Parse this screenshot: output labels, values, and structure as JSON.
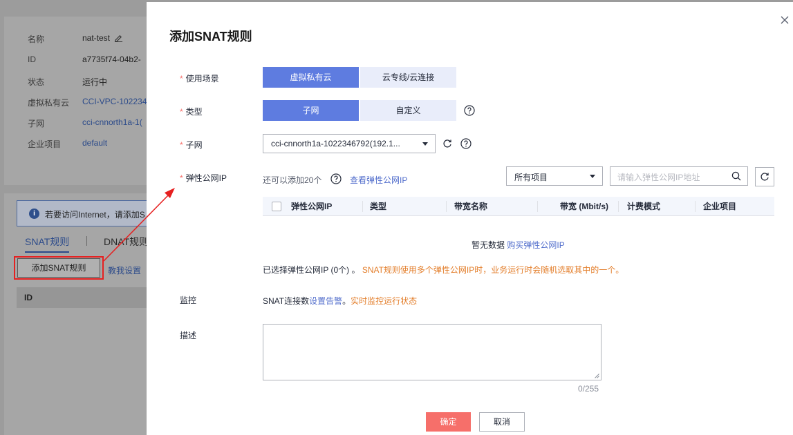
{
  "background": {
    "info": {
      "name_label": "名称",
      "name_value": "nat-test",
      "id_label": "ID",
      "id_value": "a7735f74-04b2-",
      "status_label": "状态",
      "status_value": "运行中",
      "vpc_label": "虚拟私有云",
      "vpc_value": "CCI-VPC-102234",
      "subnet_label": "子网",
      "subnet_value": "cci-cnnorth1a-1(",
      "enterprise_label": "企业项目",
      "enterprise_value": "default"
    },
    "alert_text": "若要访问Internet，请添加S",
    "tab_snat": "SNAT规则",
    "tab_dnat": "DNAT规则",
    "add_snat_button": "添加SNAT规则",
    "teach_link": "教我设置",
    "table_header_id": "ID"
  },
  "dialog": {
    "title": "添加SNAT规则",
    "scene": {
      "label": "使用场景",
      "options": [
        "虚拟私有云",
        "云专线/云连接"
      ],
      "selected": 0
    },
    "type": {
      "label": "类型",
      "options": [
        "子网",
        "自定义"
      ],
      "selected": 0
    },
    "subnet": {
      "label": "子网",
      "value": "cci-cnnorth1a-1022346792(192.1..."
    },
    "eip": {
      "label": "弹性公网IP",
      "remaining": "还可以添加20个",
      "view_link": "查看弹性公网IP",
      "project_filter": "所有项目",
      "search_placeholder": "请输入弹性公网IP地址",
      "columns": [
        "弹性公网IP",
        "类型",
        "带宽名称",
        "带宽 (Mbit/s)",
        "计费模式",
        "企业项目"
      ],
      "empty_text": "暂无数据",
      "buy_link": "购买弹性公网IP",
      "selected_text": "已选择弹性公网IP (0个) 。",
      "warning_text": "SNAT规则使用多个弹性公网IP时，业务运行时会随机选取其中的一个。"
    },
    "monitor": {
      "label": "监控",
      "prefix": "SNAT连接数",
      "alarm_link": "设置告警",
      "period": "。",
      "realtime_link": "实时监控运行状态"
    },
    "description": {
      "label": "描述",
      "value": "",
      "counter": "0/255"
    },
    "ok_button": "确定",
    "cancel_button": "取消"
  },
  "colors": {
    "primary": "#5e7ce0",
    "danger": "#f66f6a",
    "link": "#526ecc",
    "warning": "#e37d29",
    "annotation": "#e62020"
  }
}
